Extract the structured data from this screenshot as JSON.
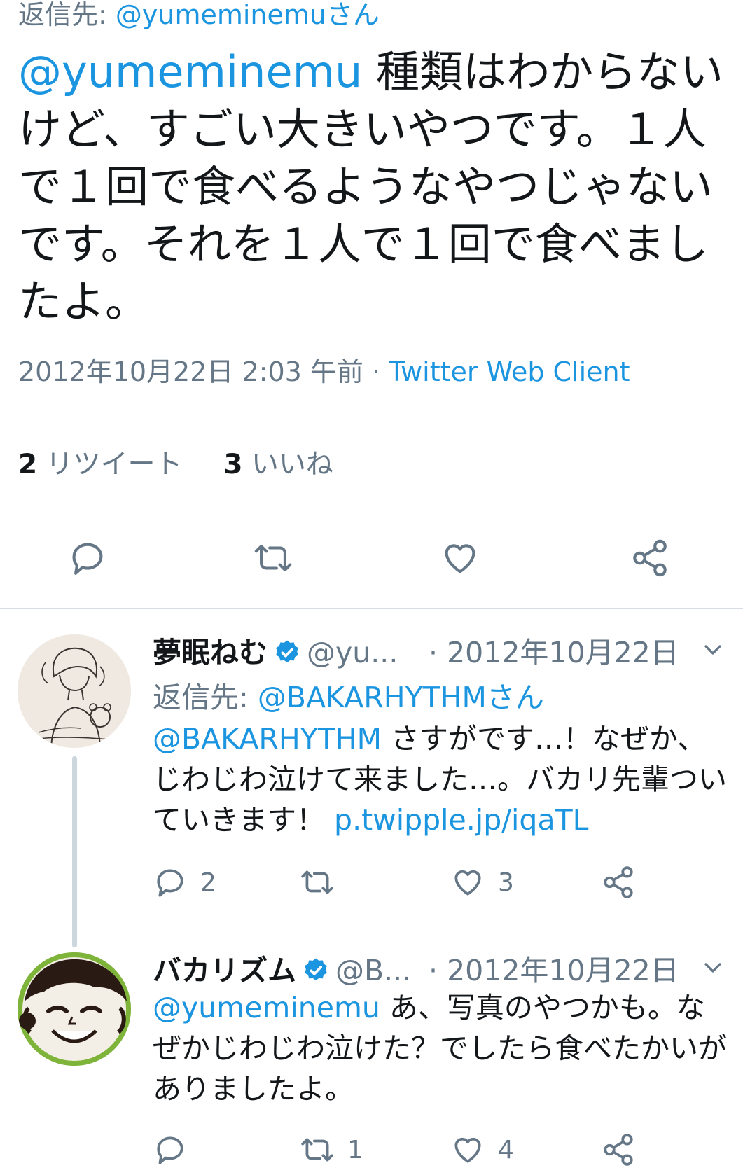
{
  "main_tweet": {
    "reply_prefix": "返信先: ",
    "reply_handle": "@yumeminemuさん",
    "mention": "@yumeminemu",
    "text": " 種類はわからないけど、すごい大きいやつです。１人で１回で食べるようなやつじゃないです。それを１人で１回で食べましたよ。",
    "timestamp": "2012年10月22日 2:03 午前",
    "separator": " · ",
    "client": "Twitter Web Client",
    "retweet_count": "2",
    "retweet_label": " リツイート",
    "like_count": "3",
    "like_label": " いいね"
  },
  "colors": {
    "link": "#1b95e0",
    "muted": "#657786",
    "text": "#14171a",
    "thread": "#ccd6dd"
  },
  "replies": [
    {
      "name": "夢眠ねむ",
      "handle": "@yu...",
      "date": "· 2012年10月22日",
      "reply_prefix": "返信先: ",
      "reply_handle": "@BAKARHYTHMさん",
      "mention": "@BAKARHYTHM",
      "text": " さすがです…！なぜか、じわじわ泣けて来ました…。バカリ先輩ついていきます！ ",
      "link": "p.twipple.jp/iqaTL",
      "reply_count": "2",
      "retweet_count": "",
      "like_count": "3"
    },
    {
      "name": "バカリズム",
      "handle": "@B...",
      "date": "· 2012年10月22日",
      "mention": "@yumeminemu",
      "text": " あ、写真のやつかも。なぜかじわじわ泣けた？でしたら食べたかいがありましたよ。",
      "reply_count": "",
      "retweet_count": "1",
      "like_count": "4"
    }
  ],
  "icons": {
    "reply": "reply-icon",
    "retweet": "retweet-icon",
    "like": "heart-icon",
    "share": "share-icon",
    "verified": "verified-badge-icon",
    "caret": "chevron-down-icon"
  }
}
